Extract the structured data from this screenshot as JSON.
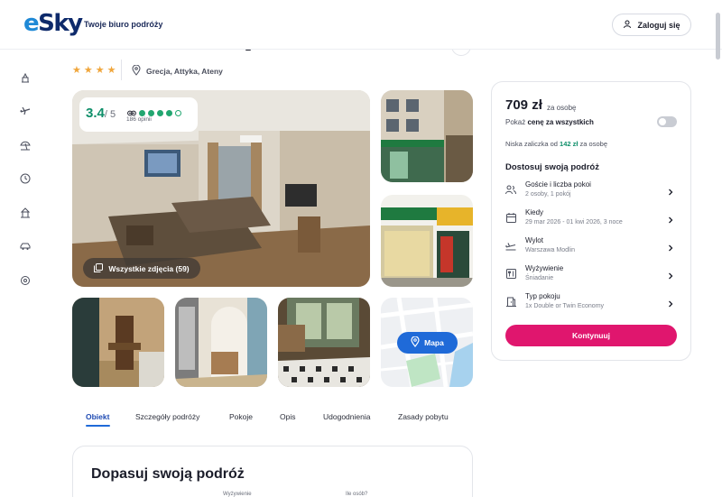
{
  "header": {
    "logo": "eSky",
    "tagline": "Twoje biuro podróży",
    "login_label": "Zaloguj się"
  },
  "sidebar": {
    "icons": [
      "hotel-icon",
      "flight-icon",
      "beach-icon",
      "clock-icon",
      "tour-icon",
      "car-icon",
      "settings-icon"
    ]
  },
  "hotel": {
    "stars": "★★★★",
    "location": "Grecja, Attyka, Ateny"
  },
  "gallery": {
    "rating": "3.4",
    "rating_of": "/ 5",
    "tripadvisor_filled": 4,
    "tripadvisor_total": 5,
    "opinions": "186 opinii",
    "all_photos_label": "Wszystkie zdjęcia (59)",
    "map_label": "Mapa"
  },
  "tabs": [
    {
      "label": "Obiekt",
      "active": true
    },
    {
      "label": "Szczegóły podróży",
      "active": false
    },
    {
      "label": "Pokoje",
      "active": false
    },
    {
      "label": "Opis",
      "active": false
    },
    {
      "label": "Udogodnienia",
      "active": false
    },
    {
      "label": "Zasady pobytu",
      "active": false
    }
  ],
  "bottom": {
    "title": "Dopasuj swoją podróż",
    "field_labels": [
      "Wyżywienie",
      "Ile osób?"
    ]
  },
  "panel": {
    "price": "709 zł",
    "price_unit": "za osobę",
    "show_total_prefix": "Pokaż ",
    "show_total_bold": "cenę za wszystkich",
    "deposit_prefix": "Niska zaliczka od ",
    "deposit_amount": "142 zł",
    "deposit_suffix": " za osobę",
    "customize_title": "Dostosuj swoją podróż",
    "options": [
      {
        "title": "Goście i liczba pokoi",
        "subtitle": "2 osoby, 1 pokój",
        "icon": "guests-icon"
      },
      {
        "title": "Kiedy",
        "subtitle": "29 mar 2026 - 01 kwi 2026, 3 noce",
        "icon": "calendar-icon"
      },
      {
        "title": "Wylot",
        "subtitle": "Warszawa Modlin",
        "icon": "departure-icon"
      },
      {
        "title": "Wyżywienie",
        "subtitle": "Śniadanie",
        "icon": "meal-icon"
      },
      {
        "title": "Typ pokoju",
        "subtitle": "1x Double or Twin Economy",
        "icon": "room-icon"
      }
    ],
    "continue_label": "Kontynuuj"
  },
  "colors": {
    "brand_pink": "#e0166e",
    "brand_blue": "#1f6ad8",
    "rating_green": "#0f8f6a",
    "star": "#f0a63c"
  }
}
